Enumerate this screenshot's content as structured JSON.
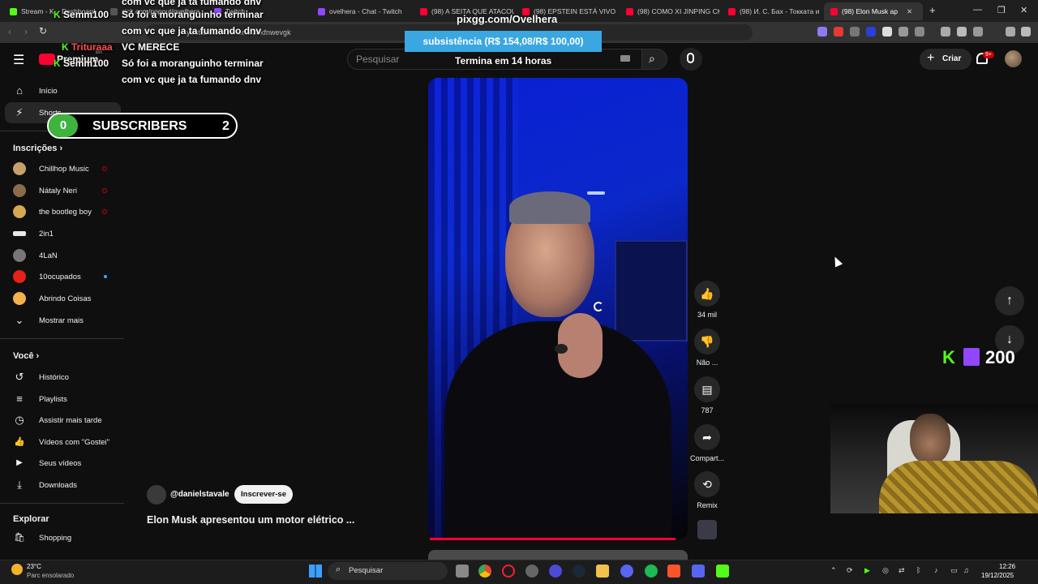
{
  "browser": {
    "tabs": [
      {
        "label": "Stream - K... Dashboard",
        "color": "#53fc18"
      },
      {
        "label": "sick.com/popout/ovelhera",
        "color": "#555555"
      },
      {
        "label": "Twitch",
        "color": "#9146ff"
      },
      {
        "label": "ovelhera - Chat - Twitch",
        "color": "#9146ff"
      },
      {
        "label": "(98) A SEITA QUE ATACOU",
        "color": "#ff0033"
      },
      {
        "label": "(98) EPSTEIN ESTÁ VIVO E",
        "color": "#ff0033"
      },
      {
        "label": "(98) COMO XI JINPING CH",
        "color": "#ff0033"
      },
      {
        "label": "(98) И. С. Бах - Токката и",
        "color": "#ff0033"
      },
      {
        "label": "(98) Elon Musk ap",
        "color": "#ff0033"
      }
    ],
    "new_tab": "+",
    "url": "youtube.com/shorts/3okfnwevgk"
  },
  "youtube": {
    "logo_text": "Premium",
    "logo_region": "BR",
    "search_placeholder": "Pesquisar",
    "create_label": "Criar",
    "notif_count": "9+"
  },
  "sidebar": {
    "main": [
      {
        "label": "Início",
        "icon": "home-icon",
        "glyph": "⌂"
      },
      {
        "label": "Shorts",
        "icon": "shorts-icon",
        "glyph": "⚡"
      }
    ],
    "subs_heading": "Inscrições",
    "subs": [
      {
        "label": "Chillhop Music",
        "color": "#c9a06b",
        "live": true
      },
      {
        "label": "Nátaly Neri",
        "color": "#8b6b4a",
        "live": true
      },
      {
        "label": "the bootleg boy",
        "color": "#d6a84f",
        "live": true
      },
      {
        "label": "2in1",
        "color": "#e8e8e8",
        "live": false
      },
      {
        "label": "4LaN",
        "color": "#777777",
        "live": false
      },
      {
        "label": "10ocupados",
        "color": "#e62117",
        "live": false,
        "dot": true
      },
      {
        "label": "Abrindo Coisas",
        "color": "#f2b14a",
        "live": false
      }
    ],
    "show_more": "Mostrar mais",
    "you_heading": "Você",
    "you": [
      {
        "label": "Histórico",
        "icon": "history-icon",
        "glyph": "↺"
      },
      {
        "label": "Playlists",
        "icon": "playlists-icon",
        "glyph": "≡"
      },
      {
        "label": "Assistir mais tarde",
        "icon": "watch-later-icon",
        "glyph": "◷"
      },
      {
        "label": "Vídeos com \"Gostei\"",
        "icon": "liked-icon",
        "glyph": "👍"
      },
      {
        "label": "Seus vídeos",
        "icon": "your-videos-icon",
        "glyph": "▶"
      },
      {
        "label": "Downloads",
        "icon": "downloads-icon",
        "glyph": "⤓"
      }
    ],
    "explore_heading": "Explorar",
    "explore": [
      {
        "label": "Shopping",
        "icon": "shopping-icon",
        "glyph": "🛍"
      }
    ]
  },
  "short": {
    "channel": "@danielstavale",
    "subscribe_label": "Inscrever-se",
    "title": "Elon Musk apresentou um motor elétrico ...",
    "actions": {
      "likes": "34 mil",
      "dislike": "Não ...",
      "comments": "787",
      "share": "Compart...",
      "remix": "Remix"
    },
    "progress": 0.97
  },
  "overlay": {
    "pix_url": "pixgg.com/Ovelhera",
    "pix_bar": "subsistência (R$ 154,08/R$ 100,00)",
    "pix_fraction": 1.0,
    "ends_in": "Termina em 14 horas",
    "chat": [
      {
        "user": "Semm100",
        "text": "Só foi a moranguinho terminar"
      },
      {
        "user": "",
        "text": "com vc que ja ta fumando dnv"
      },
      {
        "user": "Trituraaa",
        "text": "VC MERECE"
      },
      {
        "user": "Semm100",
        "text": "Só foi a moranguinho terminar"
      },
      {
        "user": "",
        "text": "com vc que ja ta fumando dnv"
      }
    ],
    "chat_top_partial": "com vc que ja ta fumando dnv",
    "sub_counter": {
      "current": "0",
      "label": "SUBSCRIBERS",
      "goal": "2"
    },
    "viewers": "200"
  },
  "taskbar": {
    "weather_temp": "23°C",
    "weather_desc": "Parc ensolarado",
    "search_label": "Pesquisar",
    "time": "12:26",
    "date": "19/12/2025"
  }
}
